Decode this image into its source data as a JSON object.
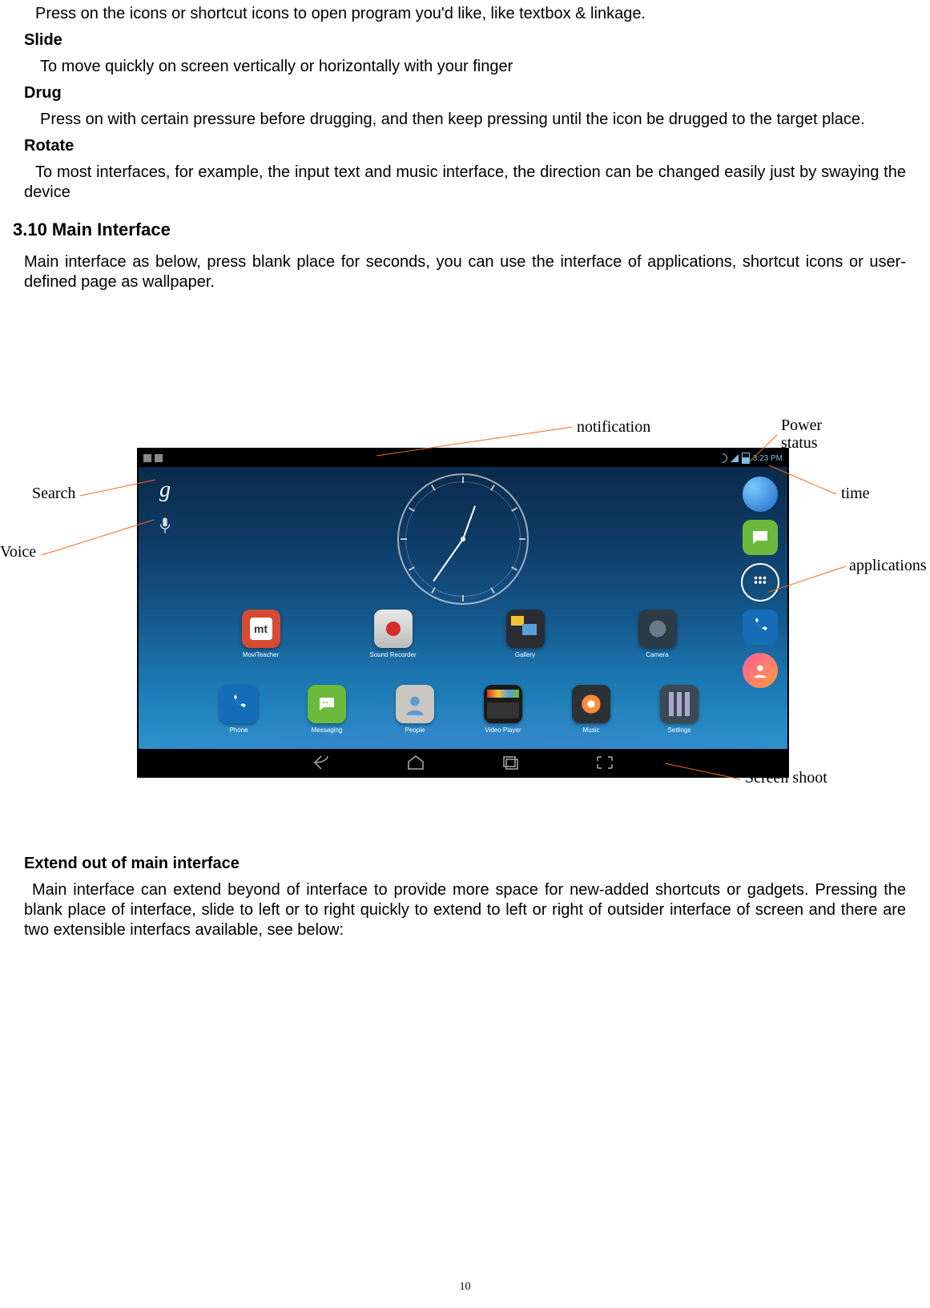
{
  "para_press": "Press on the icons or shortcut icons to open program you'd like, like textbox & linkage.",
  "h_slide": "Slide",
  "para_slide": "To move quickly on screen vertically or horizontally with your finger",
  "h_drug": "Drug",
  "para_drug": "Press on with certain pressure before drugging, and then keep pressing until the icon be drugged to the target place.",
  "h_rotate": "Rotate",
  "para_rotate": "To most interfaces, for example, the input text and music interface,  the direction can be changed easily just by swaying the device",
  "h_section": "3.10 Main Interface",
  "para_main": "Main interface as below, press blank place for seconds, you can use the interface of applications, shortcut icons or user-defined page as wallpaper.",
  "h_extend": "Extend out of main interface",
  "para_extend": "Main interface can extend beyond of interface to provide more space for new-added shortcuts or gadgets. Pressing the blank place of interface, slide to left or to right quickly to extend to left or right of outsider interface of screen and there are two extensible interfacs available, see below:",
  "page_number": "10",
  "annotations": {
    "search": "Search",
    "voice": "Voice",
    "notification": "notification",
    "power1": "Power",
    "power2": "status",
    "time": "time",
    "applications": "applications",
    "screenshot": "Screen shoot"
  },
  "screenshot": {
    "status_time": "3:23 PM",
    "row1": [
      {
        "label": "MoviTeacher",
        "bg": "#d64b32",
        "overlay": "mt"
      },
      {
        "label": "Sound Recorder",
        "bg": "#d9d9d9",
        "overlay": "rec"
      },
      {
        "label": "Gallery",
        "bg": "#2b2b33",
        "overlay": "gallery"
      },
      {
        "label": "Camera",
        "bg": "#304050",
        "overlay": "camera"
      }
    ],
    "row2": [
      {
        "label": "Phone",
        "bg": "#156db8",
        "overlay": "phone"
      },
      {
        "label": "Messaging",
        "bg": "#6cba3c",
        "overlay": "msg"
      },
      {
        "label": "People",
        "bg": "#c9c7bf",
        "overlay": "people"
      },
      {
        "label": "Video Player",
        "bg": "#1a1a1a",
        "overlay": "video"
      },
      {
        "label": "Music",
        "bg": "#2c3233",
        "overlay": "music"
      },
      {
        "label": "Settings",
        "bg": "#3a4a55",
        "overlay": "settings"
      }
    ]
  }
}
